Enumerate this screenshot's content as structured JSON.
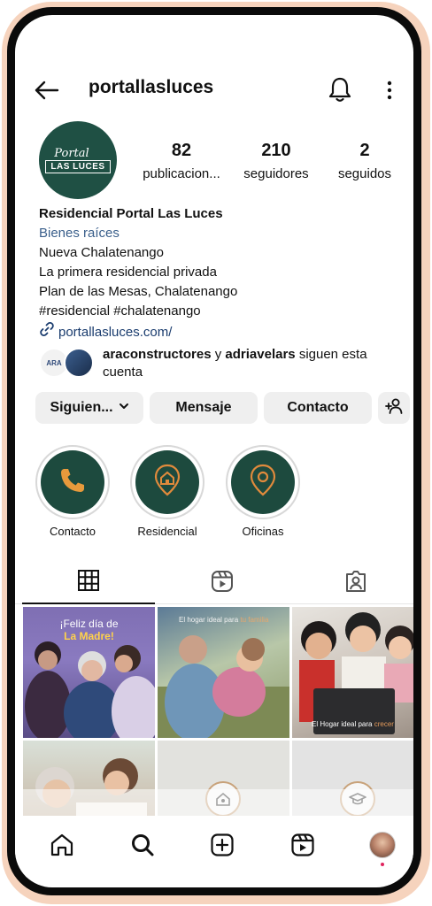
{
  "header": {
    "username": "portallasluces"
  },
  "profile": {
    "avatar_script": "Portal",
    "avatar_box": "LAS LUCES",
    "stats": [
      {
        "value": "82",
        "label": "publicaciones"
      },
      {
        "value": "210",
        "label": "seguidores"
      },
      {
        "value": "2",
        "label": "seguidos"
      }
    ],
    "posts_label_display": "publicacion...",
    "bio": {
      "name": "Residencial Portal Las Luces",
      "category": "Bienes raíces",
      "lines": [
        "Nueva Chalatenango",
        "La primera residencial privada",
        "Plan de las Mesas, Chalatenango",
        "#residencial #chalatenango"
      ],
      "link": "portallasluces.com/"
    },
    "followed_by": {
      "mini_avatar_text": "ARA",
      "user1": "araconstructores",
      "conjunction": "y",
      "user2": "adriavelars",
      "suffix": "siguen esta cuenta"
    }
  },
  "actions": {
    "following": "Siguien...",
    "message": "Mensaje",
    "contact": "Contacto"
  },
  "highlights": [
    {
      "label": "Contacto",
      "icon": "phone-icon"
    },
    {
      "label": "Residencial",
      "icon": "house-pin-icon"
    },
    {
      "label": "Oficinas",
      "icon": "location-pin-icon"
    }
  ],
  "tabs": [
    "grid-icon",
    "reels-icon",
    "tagged-icon"
  ],
  "posts": {
    "p1": {
      "line1": "¡Feliz día de",
      "line2": "La Madre!"
    },
    "p2": {
      "text": "El hogar ideal para ",
      "accent": "tu familia"
    },
    "p3": {
      "text": "El Hogar ideal para ",
      "accent": "crecer"
    }
  },
  "colors": {
    "brand_green": "#1d4a3e",
    "accent_orange": "#e08a3c",
    "link_blue": "#1a3c6e",
    "frame_peach": "#f6d3bd"
  },
  "bottom_nav": [
    "home-icon",
    "search-icon",
    "create-icon",
    "reels-icon",
    "profile-avatar"
  ]
}
